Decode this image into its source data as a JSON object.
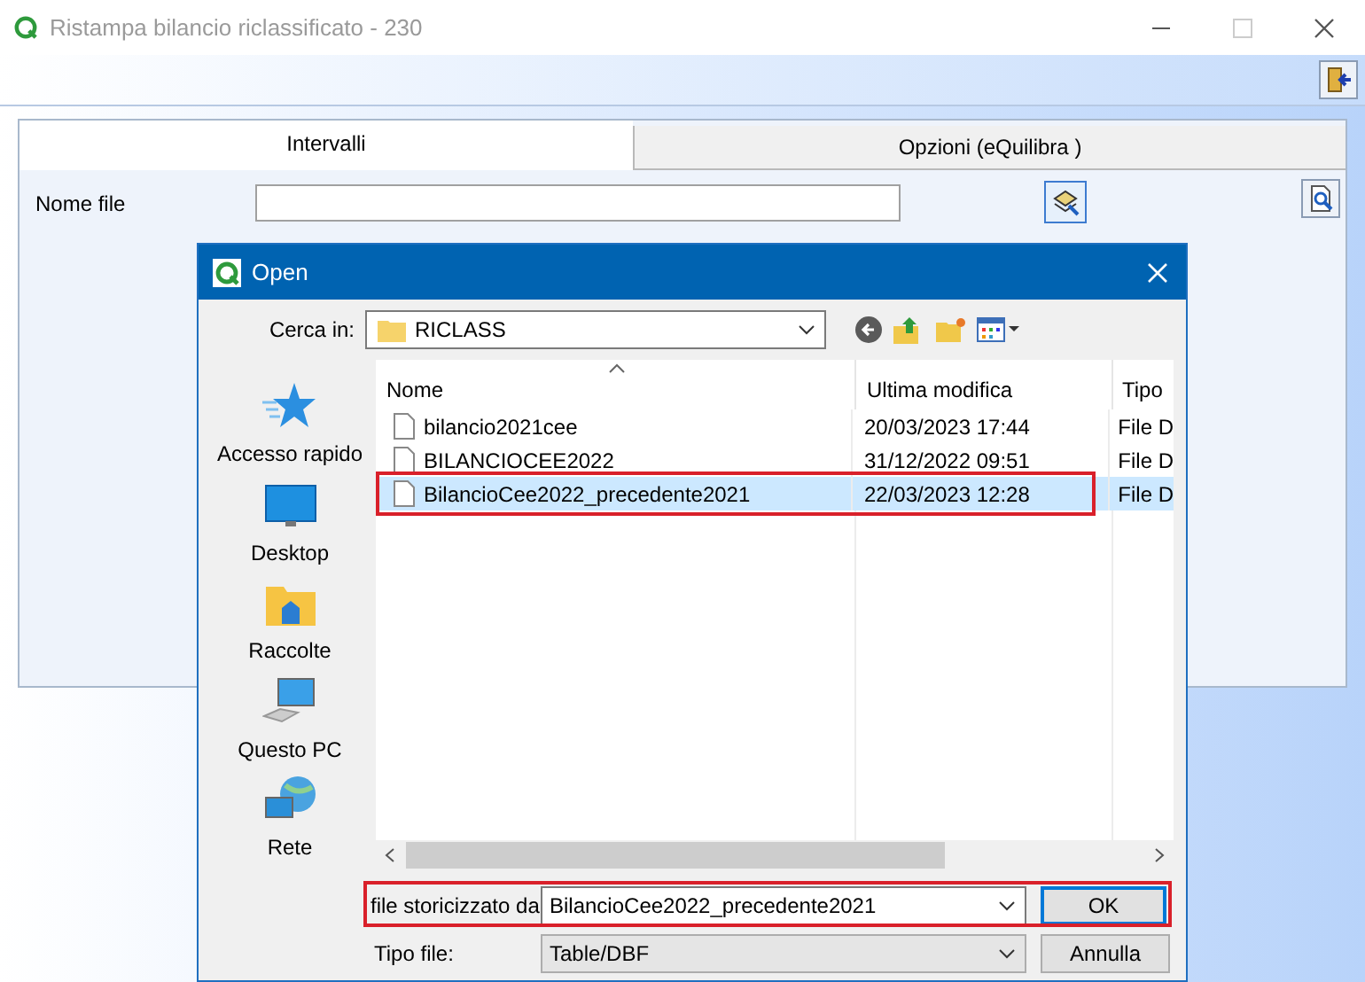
{
  "window": {
    "title": "Ristampa bilancio riclassificato - 230"
  },
  "tabs": [
    {
      "label": "Intervalli",
      "selected": true
    },
    {
      "label": "Opzioni (eQuilibra )",
      "selected": false
    }
  ],
  "form": {
    "label": "Nome file"
  },
  "dialog": {
    "title": "Open",
    "look_in_label": "Cerca in:",
    "look_in_value": "RICLASS",
    "places": [
      {
        "label": "Accesso rapido",
        "kind": "star"
      },
      {
        "label": "Desktop",
        "kind": "desktop"
      },
      {
        "label": "Raccolte",
        "kind": "library"
      },
      {
        "label": "Questo PC",
        "kind": "computer"
      },
      {
        "label": "Rete",
        "kind": "network"
      }
    ],
    "columns": [
      "Nome",
      "Ultima modifica",
      "Tipo"
    ],
    "files": [
      {
        "name": "bilancio2021cee",
        "modified": "20/03/2023 17:44",
        "type": "File D",
        "selected": false,
        "annotated": false
      },
      {
        "name": "BILANCIOCEE2022",
        "modified": "31/12/2022 09:51",
        "type": "File D",
        "selected": false,
        "annotated": false
      },
      {
        "name": "BilancioCee2022_precedente2021",
        "modified": "22/03/2023 12:28",
        "type": "File D",
        "selected": true,
        "annotated": true
      }
    ],
    "filename_label": "file storicizzato da",
    "filename_value": "BilancioCee2022_precedente2021",
    "filename_annotated": true,
    "filetype_label": "Tipo file:",
    "filetype_value": "Table/DBF",
    "buttons": [
      "OK",
      "Annulla"
    ]
  }
}
